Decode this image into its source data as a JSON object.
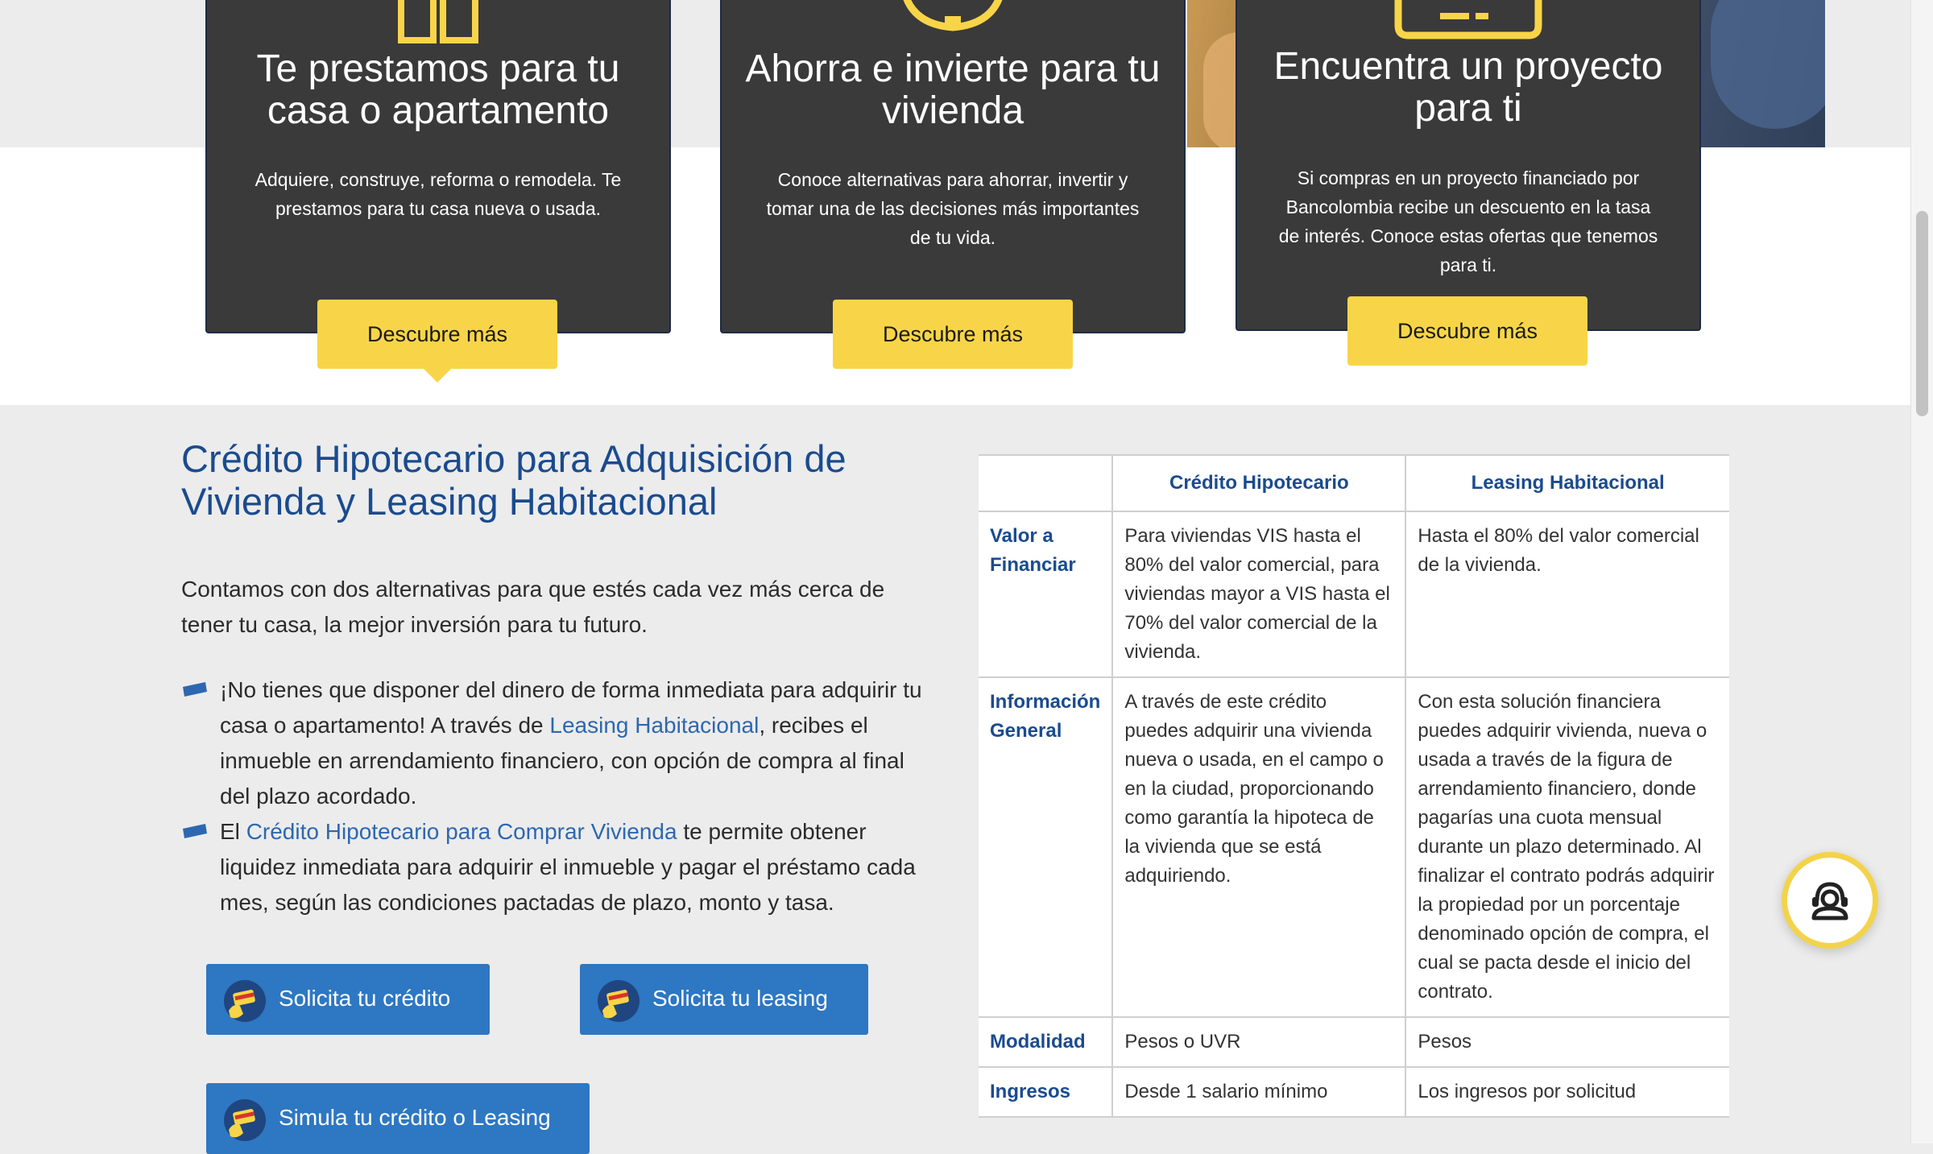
{
  "cards": [
    {
      "title": "Te prestamos para tu casa o apartamento",
      "description": "Adquiere, construye, reforma o remodela. Te prestamos para tu casa nueva o usada.",
      "button": "Descubre más",
      "icon": "building-icon"
    },
    {
      "title": "Ahorra e invierte para tu vivienda",
      "description": "Conoce alternativas para ahorrar, invertir y tomar una de las decisiones más importantes de tu vida.",
      "button": "Descubre más",
      "icon": "piggy-bank-icon"
    },
    {
      "title": "Encuentra un proyecto para ti",
      "description": "Si compras en un proyecto financiado por Bancolombia recibe un descuento en la tasa de interés. Conoce estas ofertas que tenemos para ti.",
      "button": "Descubre más",
      "icon": "ticket-icon"
    }
  ],
  "section": {
    "title": "Crédito Hipotecario para Adquisición de Vivienda y Leasing Habitacional",
    "intro": "Contamos con dos alternativas para que estés cada vez más cerca de tener tu casa, la mejor inversión para tu futuro.",
    "bullet1": {
      "before": "¡No tienes que disponer del dinero de forma inmediata para adquirir tu casa o apartamento!  A través de ",
      "link": "Leasing Habitacional",
      "after": ",  recibes el inmueble en arrendamiento financiero, con opción de compra al final del plazo acordado."
    },
    "bullet2": {
      "before": "El  ",
      "link": "Crédito Hipotecario para Comprar Vivienda",
      "after": " te permite obtener liquidez inmediata para adquirir el inmueble y  pagar el préstamo cada mes,  según las condiciones pactadas de plazo, monto y  tasa."
    }
  },
  "buttons": {
    "credito": "Solicita tu crédito",
    "leasing": "Solicita tu leasing",
    "simula": "Simula tu crédito o Leasing"
  },
  "table": {
    "headers": [
      "",
      "Crédito Hipotecario",
      "Leasing Habitacional"
    ],
    "rows": [
      {
        "label": "Valor a Financiar",
        "credito": "Para viviendas VIS hasta el 80% del valor comercial, para viviendas mayor a VIS hasta el 70% del valor comercial de la vivienda.",
        "leasing": "Hasta el 80% del valor comercial de la vivienda."
      },
      {
        "label": "Información General",
        "credito": "A través de este crédito puedes adquirir una vivienda nueva o usada, en el campo o en la ciudad, proporcionando como garantía la hipoteca de la vivienda que se está adquiriendo.",
        "leasing": "Con esta solución financiera puedes adquirir vivienda, nueva o usada a través de la figura de arrendamiento financiero, donde pagarías una cuota mensual durante un plazo determinado. Al finalizar el contrato podrás adquirir la propiedad por un porcentaje denominado opción de compra, el cual se pacta desde el inicio del contrato."
      },
      {
        "label": "Modalidad",
        "credito": "Pesos o UVR",
        "leasing": "Pesos"
      },
      {
        "label": "Ingresos",
        "credito": "Desde 1 salario mínimo",
        "leasing": "Los ingresos por solicitud"
      }
    ]
  },
  "colors": {
    "accent_yellow": "#f8d548",
    "brand_blue": "#1a4b8f",
    "button_blue": "#2e77c2",
    "card_dark": "#3a3a3a"
  },
  "chat": {
    "icon": "chat-agent-icon"
  }
}
